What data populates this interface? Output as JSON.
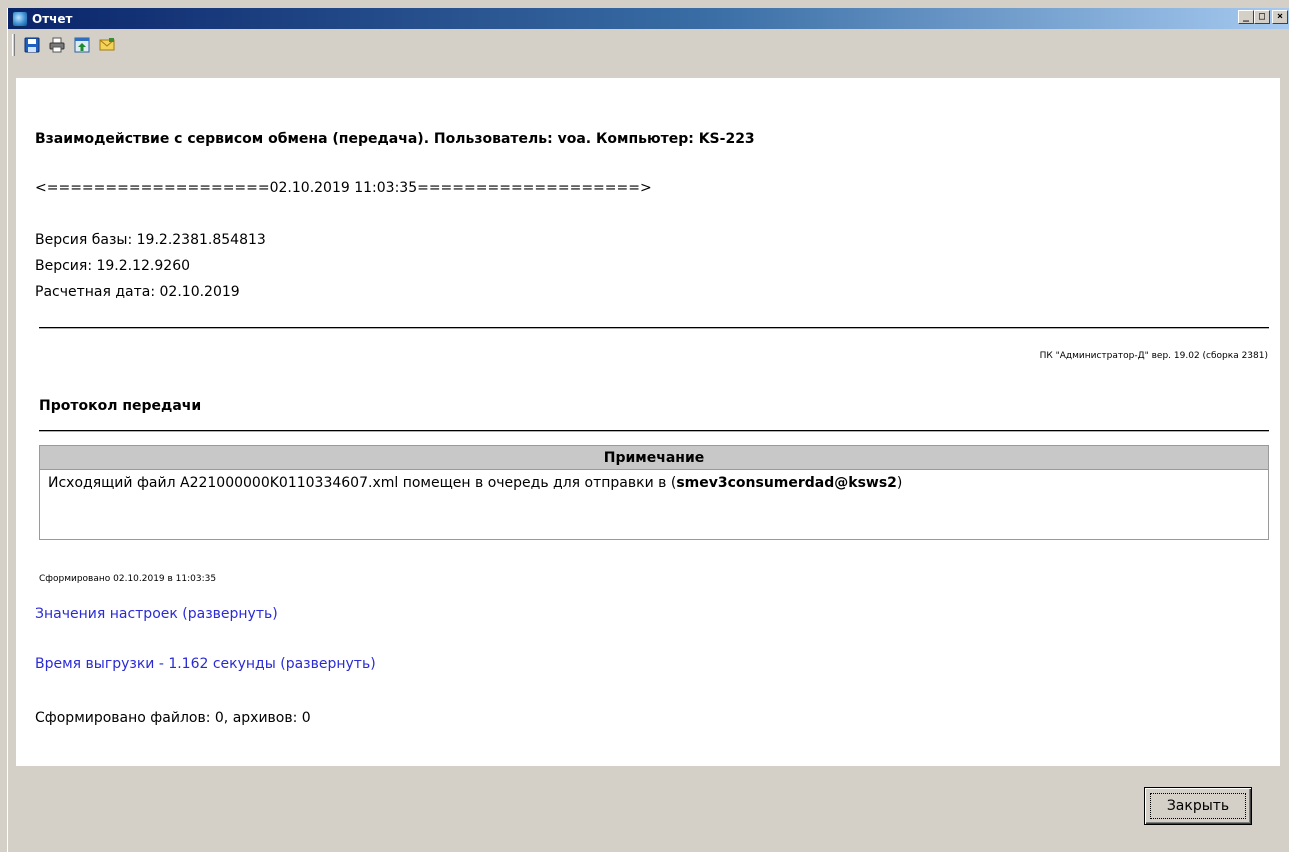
{
  "window": {
    "title": "Отчет",
    "controls": {
      "minimize": "_",
      "maximize": "□",
      "close": "×"
    }
  },
  "toolbar": {
    "items": [
      {
        "name": "save",
        "icon": "floppy-disk-icon"
      },
      {
        "name": "print",
        "icon": "printer-icon"
      },
      {
        "name": "export",
        "icon": "export-icon"
      },
      {
        "name": "send",
        "icon": "mail-envelope-icon"
      }
    ]
  },
  "report": {
    "title": "Взаимодействие с сервисом обмена (передача). Пользователь: voa. Компьютер: KS-223",
    "separator_line": "<===================02.10.2019 11:03:35===================>",
    "base_version": "Версия базы: 19.2.2381.854813",
    "app_version": "Версия: 19.2.12.9260",
    "calc_date": "Расчетная дата: 02.10.2019",
    "product_info": "ПК \"Администратор-Д\" вер. 19.02 (сборка 2381)",
    "protocol_heading": "Протокол передачи",
    "table": {
      "header": "Примечание",
      "row_text": "Исходящий файл A221000000K0110334607.xml помещен в очередь для отправки в (",
      "row_bold": "smev3consumerdad@ksws2",
      "row_end": ")"
    },
    "generated_at": "Сформировано 02.10.2019 в 11:03:35",
    "settings_link": "Значения настроек (развернуть)",
    "upload_time_link": "Время выгрузки - 1.162 секунды (развернуть)",
    "files_summary": "Сформировано файлов: 0, архивов: 0"
  },
  "footer": {
    "close_label": "Закрыть"
  },
  "colors": {
    "link": "#2b2bd6",
    "titlebar_start": "#0a246a",
    "titlebar_end": "#a6caf0"
  }
}
